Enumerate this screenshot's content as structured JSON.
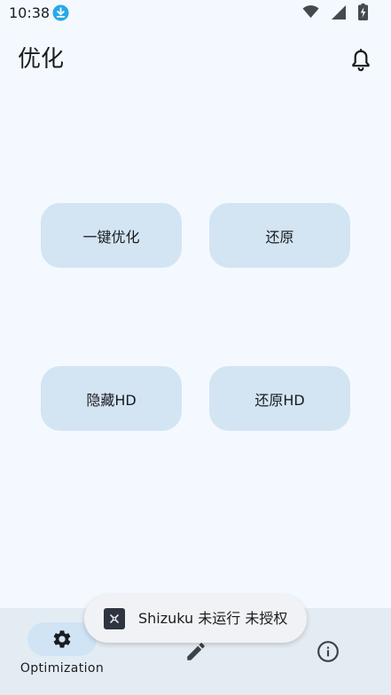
{
  "status_bar": {
    "time": "10:38",
    "download_icon": "download-icon",
    "wifi_icon": "wifi-icon",
    "signal_icon": "signal-icon",
    "battery_icon": "battery-charging-icon"
  },
  "header": {
    "title": "优化",
    "notification_icon": "bell-icon"
  },
  "actions": {
    "one_click_optimize": "一键优化",
    "restore": "还原",
    "hide_hd": "隐藏HD",
    "restore_hd": "还原HD"
  },
  "nav": {
    "items": [
      {
        "label": "Optimization",
        "icon": "gear-icon",
        "active": true
      },
      {
        "label": "",
        "icon": "pencil-icon",
        "active": false
      },
      {
        "label": "",
        "icon": "info-icon",
        "active": false
      }
    ]
  },
  "toast": {
    "icon": "shizuku-icon",
    "text": "Shizuku 未运行 未授权"
  },
  "colors": {
    "background": "#f3f9fe",
    "button": "#d3e4f3",
    "nav_bar": "#e4ecf3",
    "nav_active_pill": "#d0e4f5",
    "download_badge": "#29a8e8"
  }
}
